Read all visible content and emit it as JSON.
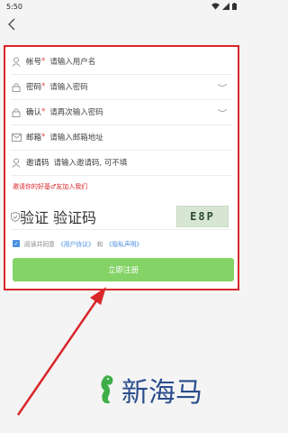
{
  "status": {
    "time": "5:50"
  },
  "form": {
    "fields": [
      {
        "label": "帐号",
        "required": true,
        "placeholder": "请输入用户名"
      },
      {
        "label": "密码",
        "required": true,
        "placeholder": "请输入密码"
      },
      {
        "label": "确认",
        "required": true,
        "placeholder": "请再次输入密码"
      },
      {
        "label": "邮箱",
        "required": true,
        "placeholder": "请输入邮箱地址"
      },
      {
        "label": "邀请码",
        "required": false,
        "placeholder": "请输入邀请码, 可不填"
      }
    ],
    "invite_text": "邀请你的好基♂友加入我们",
    "captcha": {
      "label": "验证",
      "placeholder": "验证码",
      "code": "E8P"
    },
    "agree": {
      "prefix": "阅读并同意",
      "terms": "《用户协议》",
      "and": "和",
      "privacy": "《隐私声明》"
    },
    "submit_label": "立即注册"
  },
  "logo": {
    "text": "新海马"
  },
  "colors": {
    "accent": "#83d366",
    "highlight": "#d9262a",
    "link": "#4b8fe1"
  }
}
